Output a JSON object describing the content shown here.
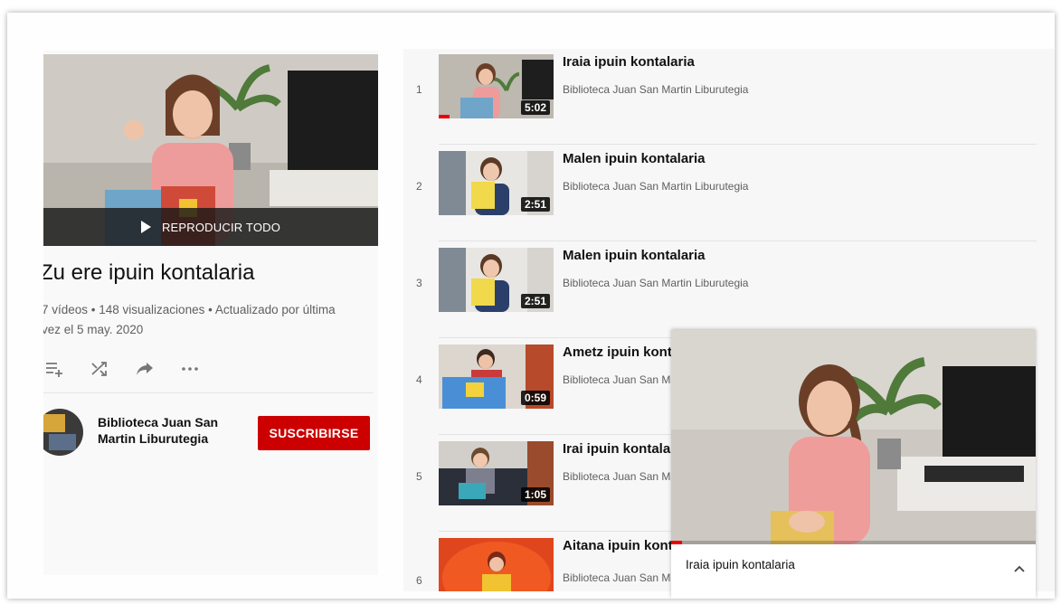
{
  "playlist": {
    "play_all_label": "REPRODUCIR TODO",
    "title": "Zu ere ipuin kontalaria",
    "stats": "7 vídeos • 148 visualizaciones • Actualizado por última vez el 5 may. 2020",
    "owner": "Biblioteca Juan San Martin Liburutegia",
    "subscribe_label": "SUSCRIBIRSE"
  },
  "videos": [
    {
      "index": "1",
      "title": "Iraia ipuin kontalaria",
      "channel": "Biblioteca Juan San Martin Liburutegia",
      "duration": "5:02",
      "watched_fraction": 0.1
    },
    {
      "index": "2",
      "title": "Malen ipuin kontalaria",
      "channel": "Biblioteca Juan San Martin Liburutegia",
      "duration": "2:51"
    },
    {
      "index": "3",
      "title": "Malen ipuin kontalaria",
      "channel": "Biblioteca Juan San Martin Liburutegia",
      "duration": "2:51"
    },
    {
      "index": "4",
      "title": "Ametz ipuin kontalaria",
      "channel": "Biblioteca Juan San Martin Liburutegia",
      "duration": "0:59"
    },
    {
      "index": "5",
      "title": "Irai ipuin kontalaria",
      "channel": "Biblioteca Juan San Martin Liburutegia",
      "duration": "1:05"
    },
    {
      "index": "6",
      "title": "Aitana ipuin kontalaria",
      "channel": "Biblioteca Juan San Martin Liburutegia",
      "duration": ""
    }
  ],
  "miniplayer": {
    "title": "Iraia ipuin kontalaria",
    "progress_fraction": 0.03
  },
  "colors": {
    "brand_red": "#cc0000",
    "progress_red": "#ee0000"
  },
  "icons": [
    "play-icon",
    "add-to-queue-icon",
    "shuffle-icon",
    "share-icon",
    "more-icon",
    "chevron-up-icon"
  ]
}
